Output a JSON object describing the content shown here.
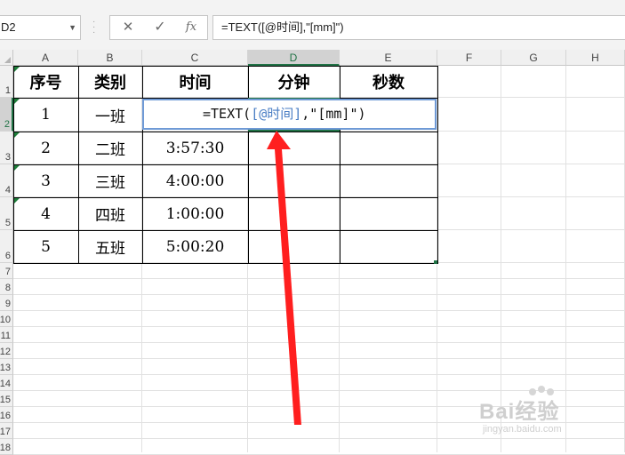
{
  "formula_bar": {
    "name_box": "D2",
    "cancel_icon": "✕",
    "enter_icon": "✓",
    "fx_icon": "fx",
    "formula": "=TEXT([@时间],\"[mm]\")"
  },
  "columns": [
    "A",
    "B",
    "C",
    "D",
    "E",
    "F",
    "G",
    "H"
  ],
  "rows": [
    "1",
    "2",
    "3",
    "4",
    "5",
    "6",
    "7",
    "8",
    "9",
    "10",
    "11",
    "12",
    "13",
    "14",
    "15",
    "16",
    "17",
    "18"
  ],
  "table": {
    "headers": [
      "序号",
      "类别",
      "时间",
      "分钟",
      "秒数"
    ],
    "rows": [
      [
        "1",
        "一班",
        "",
        "",
        ""
      ],
      [
        "2",
        "二班",
        "3:57:30",
        "",
        ""
      ],
      [
        "3",
        "三班",
        "4:00:00",
        "",
        ""
      ],
      [
        "4",
        "四班",
        "1:00:00",
        "",
        ""
      ],
      [
        "5",
        "五班",
        "5:00:20",
        "",
        ""
      ]
    ]
  },
  "in_cell_editor": {
    "prefix": "=TEXT(",
    "reference": "[@时间]",
    "suffix": ",\"[mm]\")"
  },
  "annotation": {
    "type": "red-arrow",
    "color": "#ff1f1f"
  },
  "watermark": {
    "brand": "Bai经验",
    "url": "jingyan.baidu.com"
  },
  "colors": {
    "selection": "#217346",
    "reference": "#4a7ec4"
  }
}
